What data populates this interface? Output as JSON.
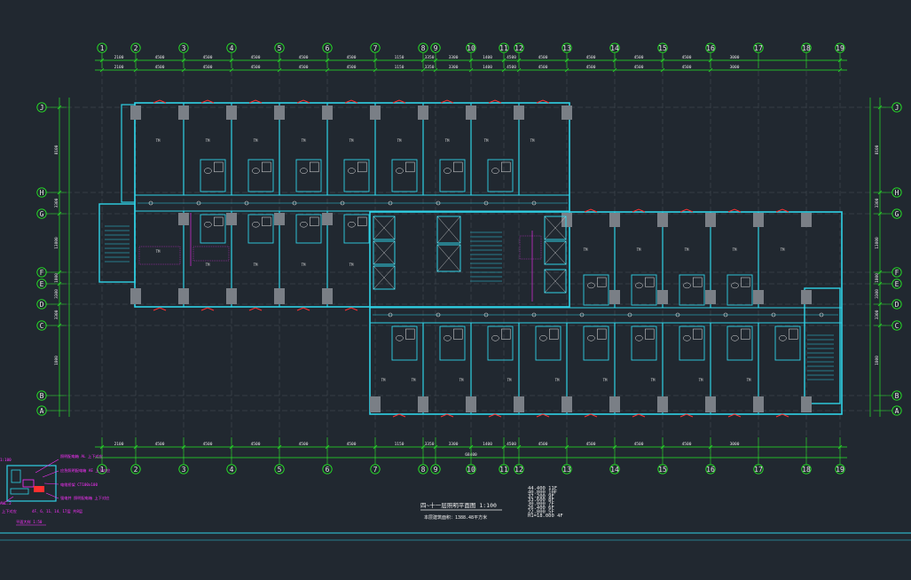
{
  "drawing": {
    "col_axes_top": [
      "1",
      "2",
      "3",
      "4",
      "5",
      "6",
      "7",
      "8",
      "9",
      "10",
      "11",
      "12",
      "13",
      "14",
      "15",
      "16",
      "17",
      "18",
      "19"
    ],
    "col_axes_bottom": [
      "1",
      "2",
      "3",
      "4",
      "5",
      "6",
      "7",
      "8",
      "9",
      "10",
      "11",
      "12",
      "13",
      "14",
      "15",
      "16",
      "17",
      "18",
      "19"
    ],
    "row_axes": [
      "J",
      "H",
      "G",
      "F",
      "E",
      "D",
      "C",
      "B",
      "A"
    ],
    "dims_top": [
      "2100",
      "4500",
      "4500",
      "4500",
      "4500",
      "4500",
      "1150",
      "3350",
      "3300",
      "1400",
      "4500",
      "4500",
      "4500",
      "4500",
      "4500",
      "3000"
    ],
    "dims_bottom": [
      "2100",
      "4500",
      "4500",
      "4500",
      "4500",
      "4500",
      "1150",
      "3350",
      "3300",
      "1400",
      "4500",
      "4500",
      "4500",
      "4500",
      "4500",
      "3000"
    ],
    "overall_dim_bottom": "68400",
    "room_label": "TM",
    "left_dims": [
      "8100",
      "3300",
      "13800",
      "1800",
      "3300",
      "3300",
      "1800"
    ],
    "right_dims": [
      "8100",
      "3300",
      "13800",
      "1800",
      "3300",
      "3300",
      "1800"
    ],
    "title": "四~十一层照明平面图  1:100",
    "subtitle": "本层建筑面积：1388.48平方米",
    "elevations": [
      "44.400  11F",
      "40.800  10F",
      "37.200   9F",
      "33.600   8F",
      "30.000   7F",
      "26.400   6F",
      "22.800   5F",
      "H1=18.000  4F"
    ],
    "legend_text": [
      "照明配电箱AL/4-11层",
      "应急照明配电箱 AL4-11层",
      "走廊照明WL",
      "平时照明灯",
      "应急照明灯",
      "疏散指示",
      "安全出口"
    ],
    "detail_labels": {
      "top_left": "1:100",
      "main": [
        "照明配电箱 AL 上下对应",
        "应急照明配电箱 AE 上下对应",
        "电缆桥架 CT100x100",
        "强电井 照明配电箱 上下对应"
      ],
      "left": [
        "AWL.2",
        "上下对应"
      ],
      "floors": "4F、6、11、14、17层 共8层",
      "scale": "平面大样 1:50"
    }
  }
}
